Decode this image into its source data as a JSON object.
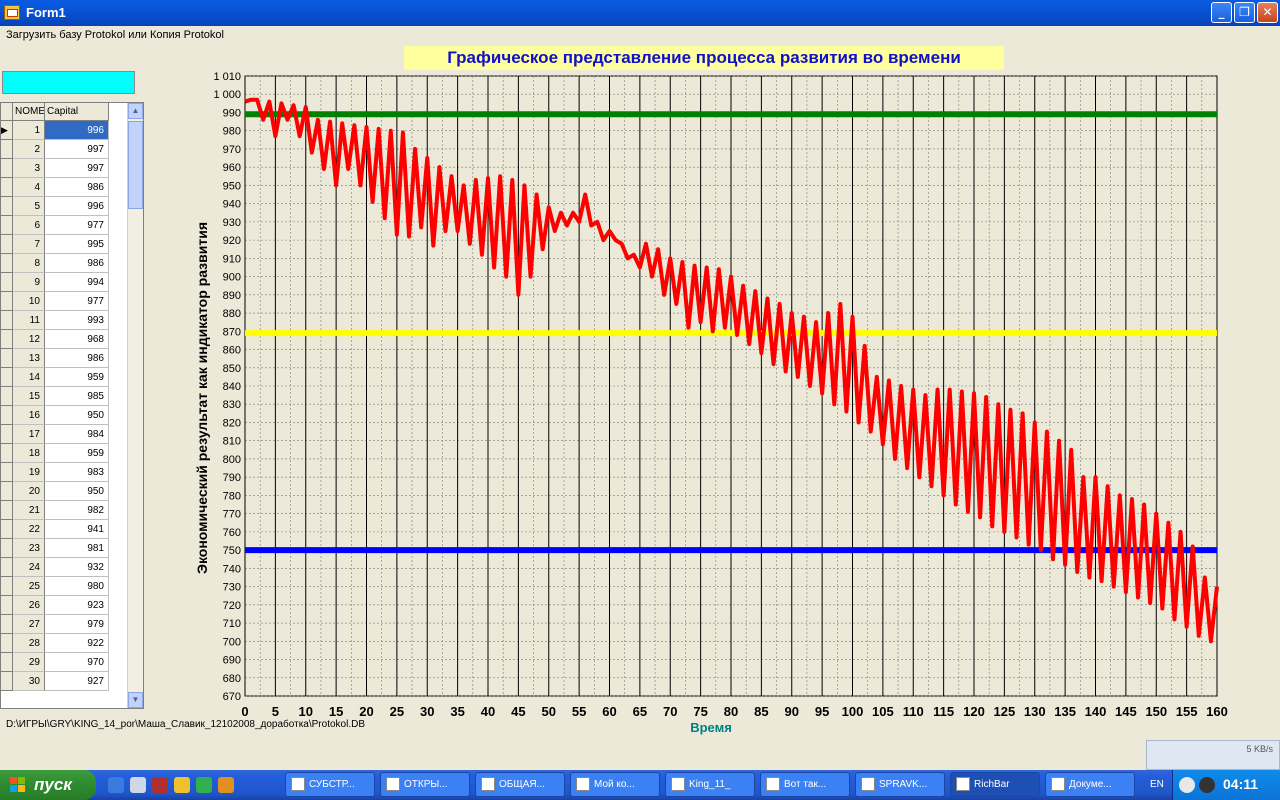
{
  "window": {
    "title": "Form1"
  },
  "menu": {
    "item": "Загрузить базу Protokol или Копия Protokol"
  },
  "grid": {
    "columns": [
      "NOMER",
      "Capital"
    ],
    "rows": [
      {
        "n": "1",
        "v": "996"
      },
      {
        "n": "2",
        "v": "997"
      },
      {
        "n": "3",
        "v": "997"
      },
      {
        "n": "4",
        "v": "986"
      },
      {
        "n": "5",
        "v": "996"
      },
      {
        "n": "6",
        "v": "977"
      },
      {
        "n": "7",
        "v": "995"
      },
      {
        "n": "8",
        "v": "986"
      },
      {
        "n": "9",
        "v": "994"
      },
      {
        "n": "10",
        "v": "977"
      },
      {
        "n": "11",
        "v": "993"
      },
      {
        "n": "12",
        "v": "968"
      },
      {
        "n": "13",
        "v": "986"
      },
      {
        "n": "14",
        "v": "959"
      },
      {
        "n": "15",
        "v": "985"
      },
      {
        "n": "16",
        "v": "950"
      },
      {
        "n": "17",
        "v": "984"
      },
      {
        "n": "18",
        "v": "959"
      },
      {
        "n": "19",
        "v": "983"
      },
      {
        "n": "20",
        "v": "950"
      },
      {
        "n": "21",
        "v": "982"
      },
      {
        "n": "22",
        "v": "941"
      },
      {
        "n": "23",
        "v": "981"
      },
      {
        "n": "24",
        "v": "932"
      },
      {
        "n": "25",
        "v": "980"
      },
      {
        "n": "26",
        "v": "923"
      },
      {
        "n": "27",
        "v": "979"
      },
      {
        "n": "28",
        "v": "922"
      },
      {
        "n": "29",
        "v": "970"
      },
      {
        "n": "30",
        "v": "927"
      }
    ]
  },
  "status": {
    "path": "D:\\ИГРЫ\\GRY\\KING_14_por\\Маша_Славик_12102008_доработка\\Protokol.DB"
  },
  "chart_data": {
    "type": "line",
    "title": "Графическое представление процесса развития во времени",
    "xlabel": "Время",
    "ylabel": "Экономический результат как индикатор развития",
    "xlim": [
      0,
      160
    ],
    "ylim": [
      670,
      1010
    ],
    "xticks": [
      0,
      5,
      10,
      15,
      20,
      25,
      30,
      35,
      40,
      45,
      50,
      55,
      60,
      65,
      70,
      75,
      80,
      85,
      90,
      95,
      100,
      105,
      110,
      115,
      120,
      125,
      130,
      135,
      140,
      145,
      150,
      155,
      160
    ],
    "ytick_step": 10,
    "grid": true,
    "reference_lines": [
      {
        "y": 989,
        "color": "#008000"
      },
      {
        "y": 869,
        "color": "#ffff00"
      },
      {
        "y": 750,
        "color": "#0000ff"
      }
    ],
    "series": [
      {
        "color": "#ff0000",
        "x": [
          0,
          1,
          2,
          3,
          4,
          5,
          6,
          7,
          8,
          9,
          10,
          11,
          12,
          13,
          14,
          15,
          16,
          17,
          18,
          19,
          20,
          21,
          22,
          23,
          24,
          25,
          26,
          27,
          28,
          29,
          30,
          31,
          32,
          33,
          34,
          35,
          36,
          37,
          38,
          39,
          40,
          41,
          42,
          43,
          44,
          45,
          46,
          47,
          48,
          49,
          50,
          51,
          52,
          53,
          54,
          55,
          56,
          57,
          58,
          59,
          60,
          61,
          62,
          63,
          64,
          65,
          66,
          67,
          68,
          69,
          70,
          71,
          72,
          73,
          74,
          75,
          76,
          77,
          78,
          79,
          80,
          81,
          82,
          83,
          84,
          85,
          86,
          87,
          88,
          89,
          90,
          91,
          92,
          93,
          94,
          95,
          96,
          97,
          98,
          99,
          100,
          101,
          102,
          103,
          104,
          105,
          106,
          107,
          108,
          109,
          110,
          111,
          112,
          113,
          114,
          115,
          116,
          117,
          118,
          119,
          120,
          121,
          122,
          123,
          124,
          125,
          126,
          127,
          128,
          129,
          130,
          131,
          132,
          133,
          134,
          135,
          136,
          137,
          138,
          139,
          140,
          141,
          142,
          143,
          144,
          145,
          146,
          147,
          148,
          149,
          150,
          151,
          152,
          153,
          154,
          155,
          156,
          157,
          158,
          159,
          160
        ],
        "y": [
          996,
          997,
          997,
          986,
          996,
          977,
          995,
          986,
          994,
          977,
          993,
          968,
          986,
          959,
          985,
          950,
          984,
          959,
          983,
          950,
          982,
          941,
          981,
          932,
          980,
          923,
          979,
          922,
          970,
          927,
          965,
          917,
          960,
          925,
          955,
          925,
          950,
          918,
          953,
          912,
          954,
          905,
          955,
          900,
          953,
          890,
          950,
          900,
          945,
          915,
          938,
          925,
          935,
          928,
          935,
          930,
          945,
          928,
          930,
          920,
          925,
          920,
          918,
          910,
          912,
          905,
          918,
          900,
          915,
          890,
          910,
          885,
          908,
          872,
          906,
          875,
          905,
          870,
          904,
          872,
          900,
          868,
          895,
          863,
          892,
          858,
          888,
          852,
          885,
          848,
          880,
          845,
          878,
          840,
          875,
          836,
          880,
          830,
          885,
          826,
          878,
          820,
          862,
          815,
          845,
          808,
          843,
          800,
          840,
          795,
          838,
          790,
          835,
          785,
          838,
          780,
          838,
          775,
          837,
          771,
          836,
          768,
          834,
          763,
          830,
          760,
          827,
          757,
          825,
          753,
          820,
          750,
          815,
          745,
          810,
          742,
          805,
          738,
          790,
          735,
          790,
          733,
          785,
          730,
          780,
          727,
          778,
          724,
          775,
          721,
          770,
          718,
          765,
          712,
          760,
          708,
          752,
          703,
          735,
          700,
          730
        ]
      }
    ]
  },
  "taskbar": {
    "start": "пуск",
    "tasks": [
      "СУБСТР...",
      "ОТКРЫ...",
      "ОБЩАЯ...",
      "Мой ко...",
      "King_11_",
      "Вот так...",
      "SPRAVK...",
      "RichBar",
      "Докуме..."
    ],
    "lang": "EN",
    "clock": "04:11",
    "net": "5 KB/s"
  }
}
